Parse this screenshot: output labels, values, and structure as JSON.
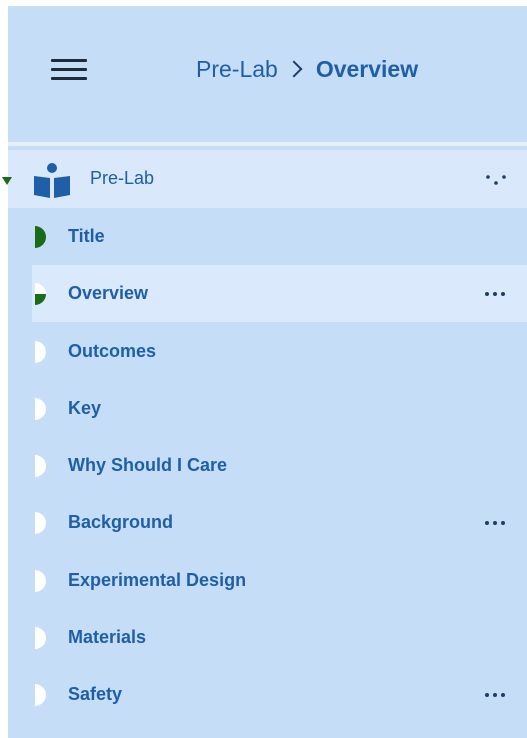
{
  "header": {
    "menu_icon": "hamburger-menu-icon",
    "breadcrumb": {
      "parent": "Pre-Lab",
      "separator_icon": "chevron-right-icon",
      "current": "Overview"
    }
  },
  "section": {
    "icon": "reader-book-icon",
    "label": "Pre-Lab",
    "menu_icon": "scattered-dots-icon"
  },
  "nav_items": [
    {
      "label": "Title",
      "status": "complete",
      "has_more": false
    },
    {
      "label": "Overview",
      "status": "partial",
      "has_more": true,
      "active": true
    },
    {
      "label": "Outcomes",
      "status": "incomplete",
      "has_more": false
    },
    {
      "label": "Key",
      "status": "incomplete",
      "has_more": false
    },
    {
      "label": "Why Should I Care",
      "status": "incomplete",
      "has_more": false
    },
    {
      "label": "Background",
      "status": "incomplete",
      "has_more": true
    },
    {
      "label": "Experimental Design",
      "status": "incomplete",
      "has_more": false
    },
    {
      "label": "Materials",
      "status": "incomplete",
      "has_more": false
    },
    {
      "label": "Safety",
      "status": "incomplete",
      "has_more": true
    }
  ],
  "colors": {
    "panel_bg": "#c6ddf7",
    "active_bg": "#daeafc",
    "text_blue": "#1f5fa8",
    "progress_green": "#1a6b1a",
    "incomplete_white": "#ffffff"
  }
}
